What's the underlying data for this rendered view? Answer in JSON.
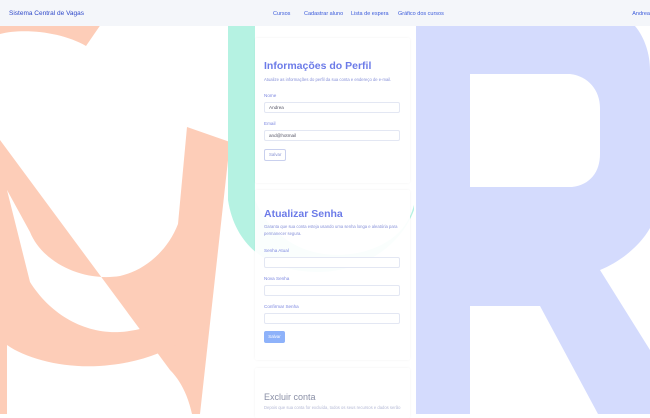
{
  "navbar": {
    "brand": "Sistema Central de Vagas",
    "links": [
      "Cursos",
      "Cadastrar aluno",
      "Lista de espera",
      "Gráfico dos cursos"
    ],
    "user": "Andrea"
  },
  "profile": {
    "title": "Informações do Perfil",
    "description": "Atualize as informações do perfil da sua conta e endereço de e-mail.",
    "name_label": "Nome",
    "name_value": "Andrea",
    "email_label": "Email",
    "email_value": "and@hotmail",
    "save_label": "Salvar"
  },
  "password": {
    "title": "Atualizar Senha",
    "description": "Garanta que sua conta esteja usando uma senha longa e aleatória para permanecer segura.",
    "current_label": "Senha Atual",
    "new_label": "Nova Senha",
    "confirm_label": "Confirmar Senha",
    "save_label": "Salvar"
  },
  "delete": {
    "title": "Excluir conta",
    "description": "Depois que sua conta for excluída, todos os seus recursos e dados serão"
  },
  "colors": {
    "letter_g": "#fdcdb8",
    "letter_u": "#b5f2e2",
    "letter_r": "#d4dbfd",
    "accent": "#6c7be8"
  }
}
